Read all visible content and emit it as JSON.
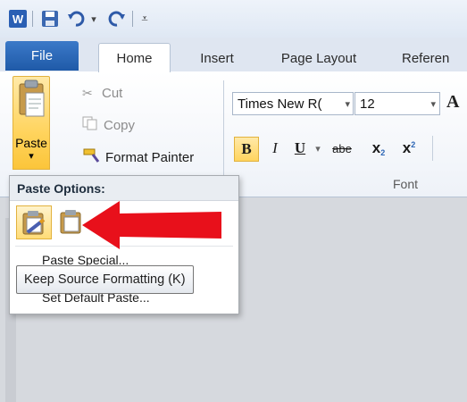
{
  "qat": {
    "app_icon": "word-icon",
    "save_icon": "save-icon",
    "undo_icon": "undo-icon",
    "dropdown_icon": "chevron-down-icon",
    "redo_icon": "redo-icon",
    "customize_icon": "customize-qat-icon"
  },
  "tabs": [
    {
      "label": "File"
    },
    {
      "label": "Home"
    },
    {
      "label": "Insert"
    },
    {
      "label": "Page Layout"
    },
    {
      "label": "Referen"
    }
  ],
  "clipboard": {
    "paste_label": "Paste",
    "paste_arrow": "▾",
    "cut_label": "Cut",
    "copy_label": "Copy",
    "format_painter_label": "Format Painter"
  },
  "font": {
    "font_name": "Times New R(",
    "font_size": "12",
    "grow_glyph": "A",
    "bold": "B",
    "italic": "I",
    "underline": "U",
    "strike": "abe",
    "subscript": "x",
    "superscript": "x",
    "group_label": "Font"
  },
  "paste_menu": {
    "header": "Paste Options:",
    "paste_special": "Paste Special...",
    "set_default": "Set Default Paste..."
  },
  "tooltip": {
    "text": "Keep Source Formatting (K)"
  },
  "colors": {
    "accent": "#2a64b4",
    "highlight": "#ffd45e",
    "arrow": "#e8101b"
  }
}
